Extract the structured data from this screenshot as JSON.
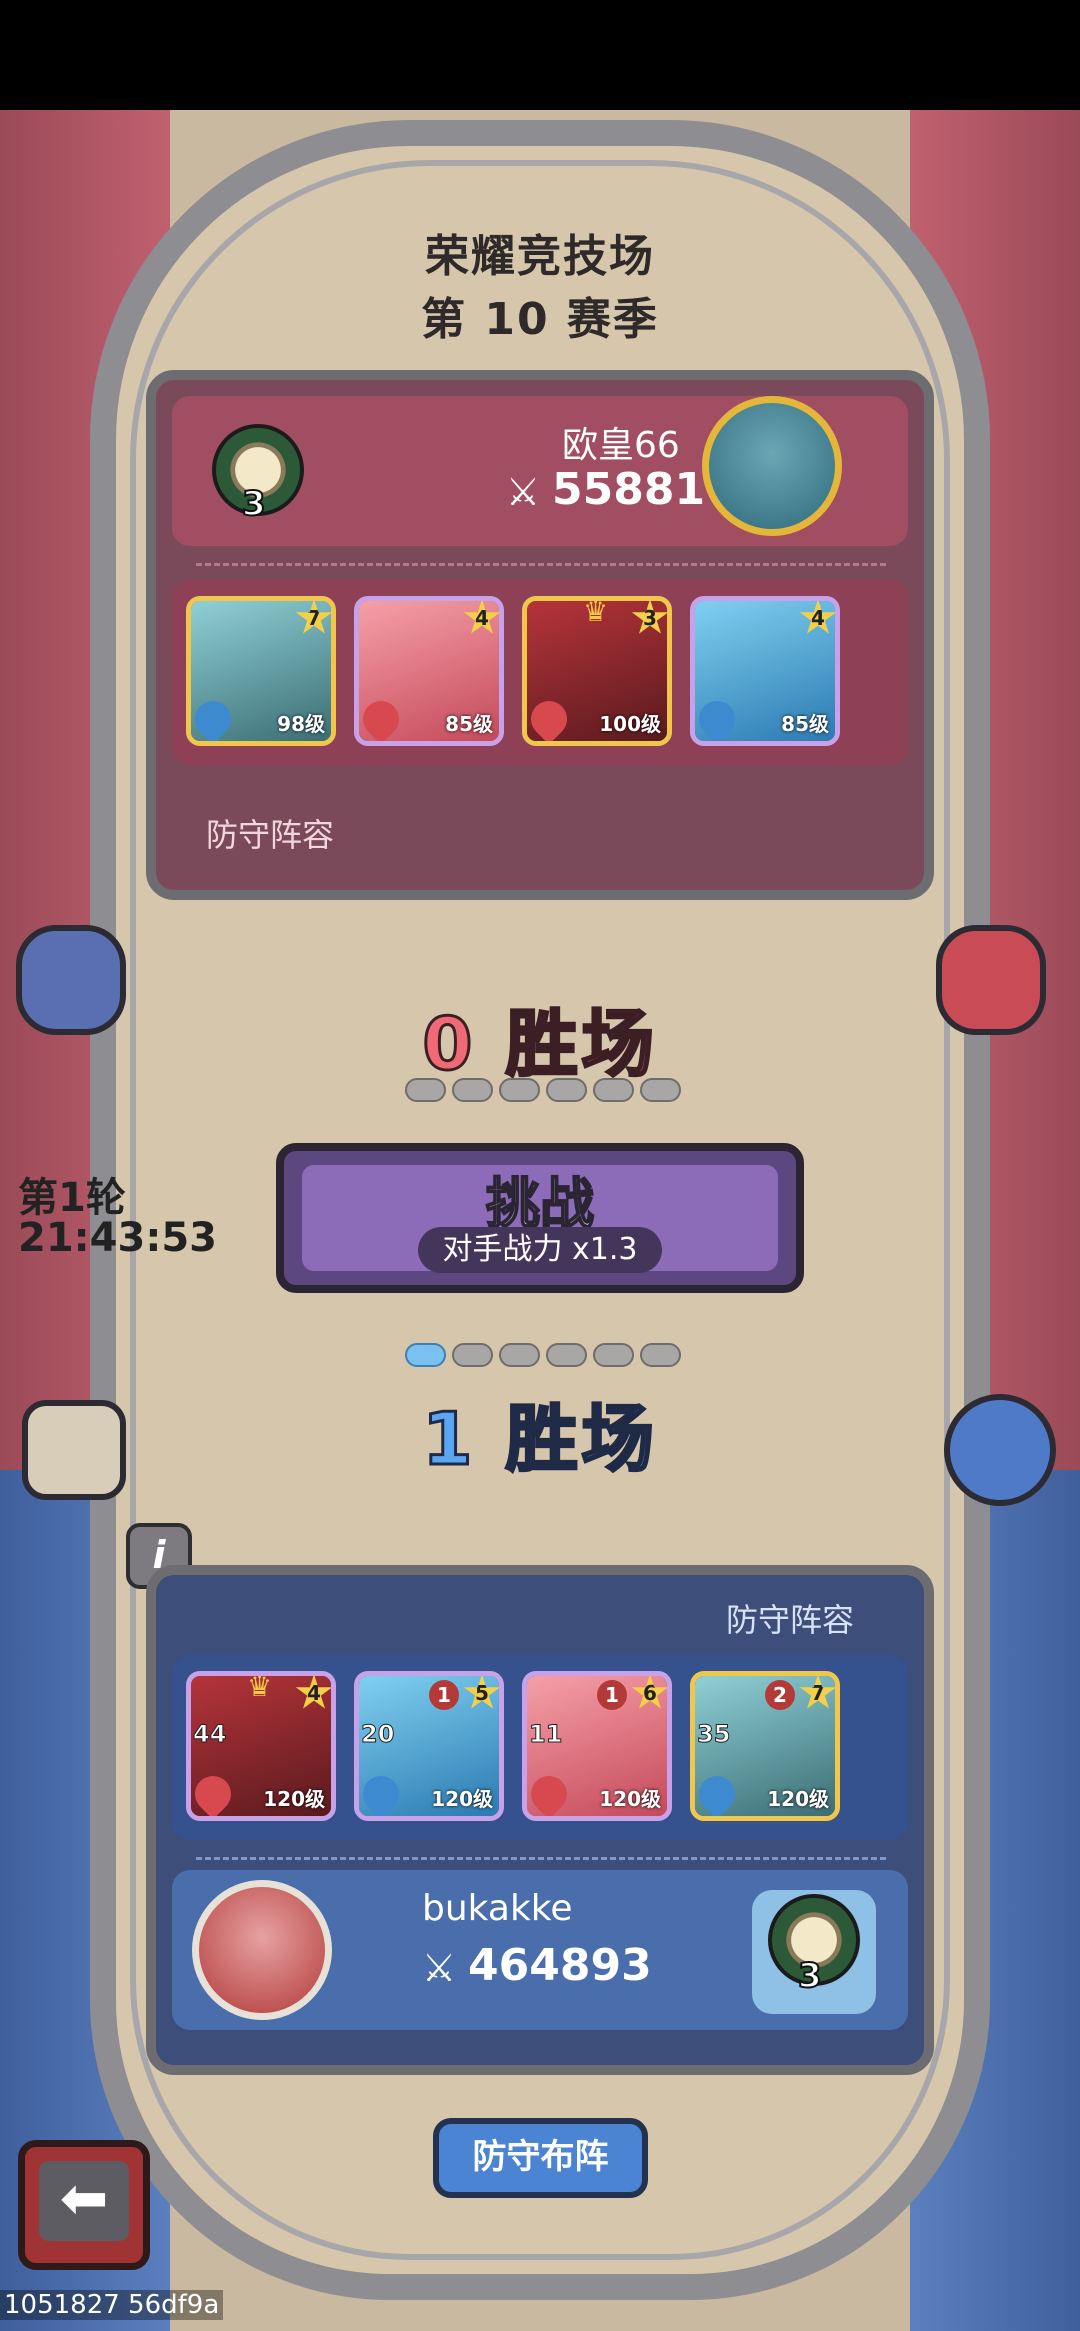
{
  "arena": {
    "title": "荣耀竞技场",
    "season": "第 10 赛季"
  },
  "opponent": {
    "name": "欧皇66",
    "power": "55881",
    "rank_coin": "3",
    "lineup_label": "防守阵容",
    "heroes": [
      {
        "level": "98级",
        "stars": "7",
        "element": "water",
        "frame": "gold"
      },
      {
        "level": "85级",
        "stars": "4",
        "element": "fire",
        "frame": "purple"
      },
      {
        "level": "100级",
        "stars": "3",
        "element": "fire",
        "frame": "gold"
      },
      {
        "level": "85级",
        "stars": "4",
        "element": "water",
        "frame": "purple"
      }
    ]
  },
  "match": {
    "opponent_wins": "0 胜场",
    "player_wins": "1 胜场",
    "opponent_pips": [
      false,
      false,
      false,
      false,
      false,
      false
    ],
    "player_pips": [
      true,
      false,
      false,
      false,
      false,
      false
    ],
    "round_label": "第1轮",
    "round_timer": "21:43:53",
    "challenge_label": "挑战",
    "challenge_sub": "对手战力 x1.3"
  },
  "player": {
    "name": "bukakke",
    "power": "464893",
    "rank_coin": "3",
    "lineup_label": "防守阵容",
    "heroes": [
      {
        "level": "120级",
        "stars": "4",
        "badge": "44",
        "element": "fire",
        "frame": "purple"
      },
      {
        "level": "120级",
        "stars": "5",
        "badge": "20",
        "element": "water",
        "frame": "purple",
        "bars": "1"
      },
      {
        "level": "120级",
        "stars": "6",
        "badge": "11",
        "element": "fire",
        "frame": "purple",
        "bars": "1"
      },
      {
        "level": "120级",
        "stars": "7",
        "badge": "35",
        "element": "water",
        "frame": "gold",
        "bars": "2"
      }
    ]
  },
  "buttons": {
    "defense_setup": "防守布阵",
    "back": "⬅",
    "info": "i"
  },
  "icons": {
    "left_top": "chest-icon",
    "right_top": "gift-basket-icon",
    "left_bottom": "magnifier-icon",
    "right_bottom": "podium-icon"
  },
  "watermark": "1051827 56df9a"
}
